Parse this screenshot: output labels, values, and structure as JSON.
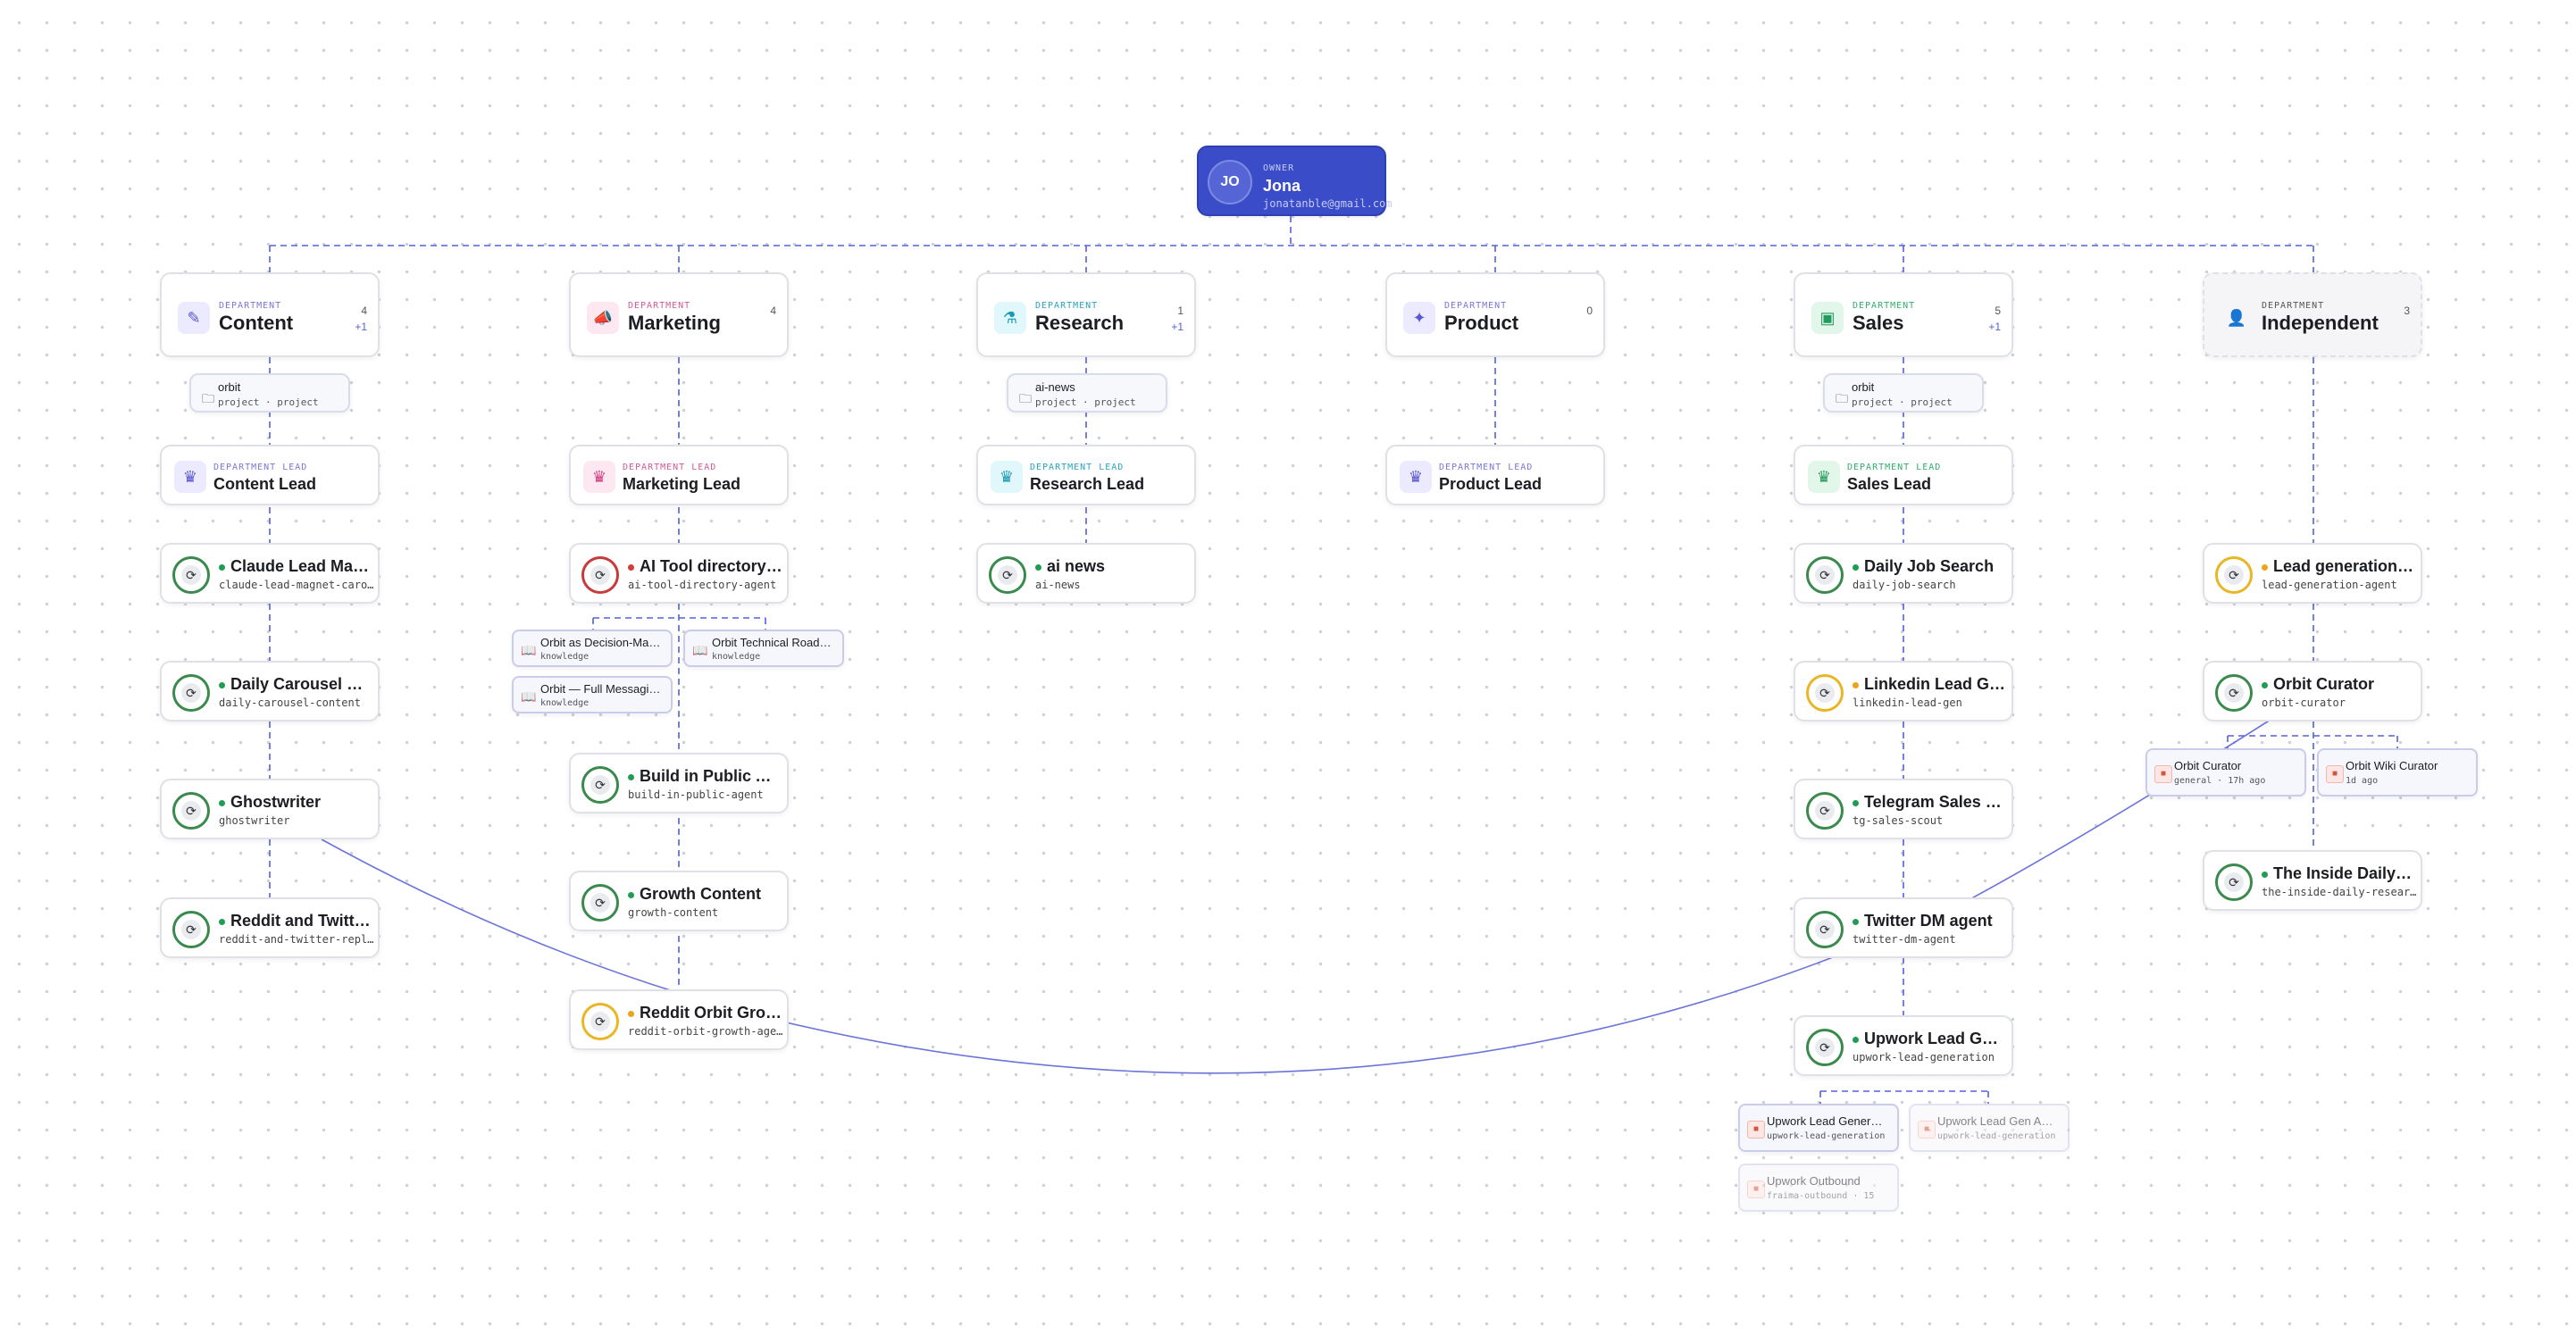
{
  "colors": {
    "owner_bg": "#3a4cc8",
    "connector": "#5561d8",
    "status_active": "#1f9d55",
    "status_warning": "#f0a21a",
    "status_error": "#d43b3b"
  },
  "owner": {
    "eyebrow": "OWNER",
    "initials": "JO",
    "name": "Jona",
    "email": "jonatanble@gmail.com"
  },
  "departments": {
    "content": {
      "eyebrow": "DEPARTMENT",
      "name": "Content",
      "count": "4",
      "extra": "+1",
      "icon": "pencil-icon"
    },
    "marketing": {
      "eyebrow": "DEPARTMENT",
      "name": "Marketing",
      "count": "4",
      "extra": "",
      "icon": "megaphone-icon"
    },
    "research": {
      "eyebrow": "DEPARTMENT",
      "name": "Research",
      "count": "1",
      "extra": "+1",
      "icon": "flask-icon"
    },
    "product": {
      "eyebrow": "DEPARTMENT",
      "name": "Product",
      "count": "0",
      "extra": "",
      "icon": "puzzle-icon"
    },
    "sales": {
      "eyebrow": "DEPARTMENT",
      "name": "Sales",
      "count": "5",
      "extra": "+1",
      "icon": "briefcase-icon"
    },
    "independent": {
      "eyebrow": "DEPARTMENT",
      "name": "Independent",
      "count": "3",
      "extra": "",
      "icon": "person-icon"
    }
  },
  "projects": {
    "content": {
      "name": "orbit",
      "meta": "project · project"
    },
    "research": {
      "name": "ai-news",
      "meta": "project · project"
    },
    "sales": {
      "name": "orbit",
      "meta": "project · project"
    }
  },
  "leads": {
    "content": {
      "eyebrow": "DEPARTMENT LEAD",
      "name": "Content Lead"
    },
    "marketing": {
      "eyebrow": "DEPARTMENT LEAD",
      "name": "Marketing Lead"
    },
    "research": {
      "eyebrow": "DEPARTMENT LEAD",
      "name": "Research Lead"
    },
    "product": {
      "eyebrow": "DEPARTMENT LEAD",
      "name": "Product Lead"
    },
    "sales": {
      "eyebrow": "DEPARTMENT LEAD",
      "name": "Sales Lead"
    }
  },
  "agents": {
    "claude_lead": {
      "name": "Claude Lead Magnet Carousel",
      "slug": "claude-lead-magnet-carousel"
    },
    "daily_carousel": {
      "name": "Daily Carousel Content",
      "slug": "daily-carousel-content"
    },
    "ghostwriter": {
      "name": "Ghostwriter",
      "slug": "ghostwriter"
    },
    "reddit_twitter": {
      "name": "Reddit and Twitter Replyguy",
      "slug": "reddit-and-twitter-replyguy"
    },
    "ai_tool": {
      "name": "AI Tool directory agent",
      "slug": "ai-tool-directory-agent"
    },
    "build_public": {
      "name": "Build in Public Agent",
      "slug": "build-in-public-agent"
    },
    "growth_content": {
      "name": "Growth Content",
      "slug": "growth-content"
    },
    "reddit_orbit": {
      "name": "Reddit Orbit Growth Agent",
      "slug": "reddit-orbit-growth-agent"
    },
    "ai_news": {
      "name": "ai news",
      "slug": "ai-news"
    },
    "daily_job": {
      "name": "Daily Job Search",
      "slug": "daily-job-search"
    },
    "linkedin_lead": {
      "name": "Linkedin Lead Gen",
      "slug": "linkedin-lead-gen"
    },
    "telegram_sales": {
      "name": "Telegram Sales Scout",
      "slug": "tg-sales-scout"
    },
    "twitter_dm": {
      "name": "Twitter DM agent",
      "slug": "twitter-dm-agent"
    },
    "upwork_lead": {
      "name": "Upwork Lead Generation",
      "slug": "upwork-lead-generation"
    },
    "lead_gen": {
      "name": "Lead generation agent",
      "slug": "lead-generation-agent"
    },
    "orbit_curator": {
      "name": "Orbit Curator",
      "slug": "orbit-curator"
    },
    "inside_daily": {
      "name": "The Inside Daily Research",
      "slug": "the-inside-daily-research"
    }
  },
  "knowledge": {
    "decision": {
      "name": "Orbit as Decision-Maker",
      "meta": "knowledge"
    },
    "technical": {
      "name": "Orbit Technical Roadmap",
      "meta": "knowledge"
    },
    "full": {
      "name": "Orbit — Full Messaging",
      "meta": "knowledge"
    }
  },
  "sessions": {
    "orbit_curator_general": {
      "name": "Orbit Curator",
      "meta": "general · 17h ago"
    },
    "orbit_wiki": {
      "name": "Orbit Wiki Curator",
      "meta": "1d ago"
    },
    "upwork_gen": {
      "name": "Upwork Lead Generation",
      "meta": "upwork-lead-generation"
    },
    "upwork_gen_a": {
      "name": "Upwork Lead Gen Agent",
      "meta": "upwork-lead-generation"
    },
    "upwork_outbound": {
      "name": "Upwork Outbound",
      "meta": "fraima-outbound · 15"
    }
  }
}
